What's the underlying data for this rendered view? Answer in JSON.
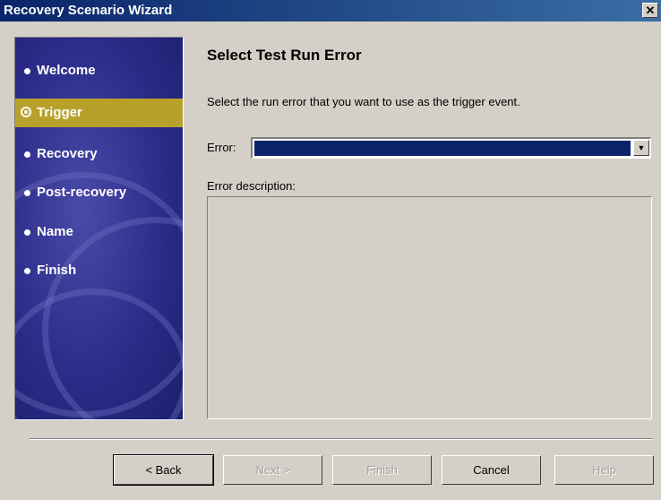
{
  "window": {
    "title": "Recovery Scenario Wizard",
    "close_glyph": "✕"
  },
  "sidebar": {
    "steps": [
      {
        "label": "Welcome",
        "active": false
      },
      {
        "label": "Trigger",
        "active": true
      },
      {
        "label": "Recovery",
        "active": false
      },
      {
        "label": "Post-recovery",
        "active": false
      },
      {
        "label": "Name",
        "active": false
      },
      {
        "label": "Finish",
        "active": false
      }
    ]
  },
  "main": {
    "title": "Select Test Run Error",
    "instruction": "Select the run error that you want to use as the trigger event.",
    "error_label": "Error:",
    "error_value": "",
    "description_label": "Error description:",
    "description_text": ""
  },
  "buttons": {
    "back": "< Back",
    "next": "Next >",
    "finish": "Finish",
    "cancel": "Cancel",
    "help": "Help"
  },
  "colors": {
    "title_bar": "#0a246a",
    "sidebar_bg": "#2c2c8a",
    "active_step": "#b8a12a",
    "selection": "#0a246a"
  }
}
